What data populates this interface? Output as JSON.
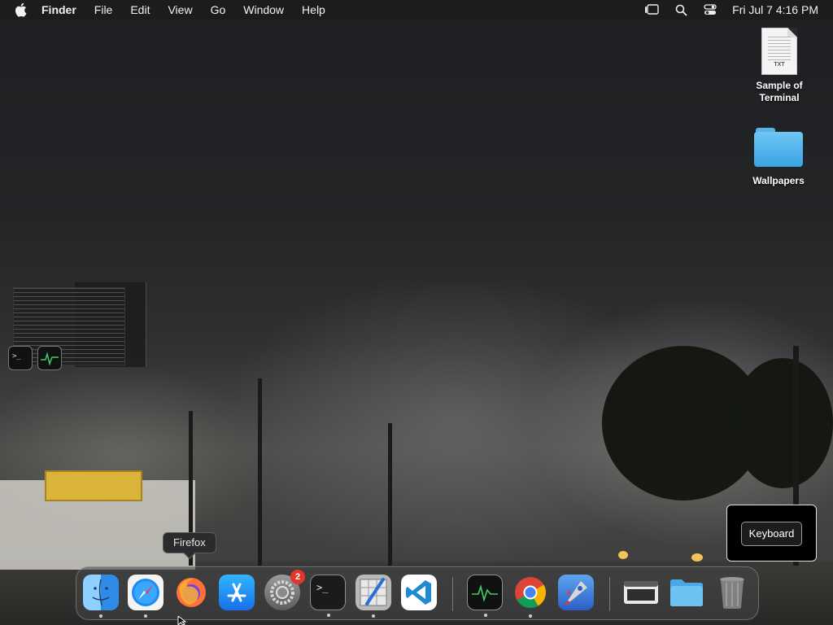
{
  "menubar": {
    "app_name": "Finder",
    "items": [
      "File",
      "Edit",
      "View",
      "Go",
      "Window",
      "Help"
    ],
    "clock": "Fri Jul 7  4:16 PM",
    "right_icons": [
      "stage-manager-icon",
      "spotlight-search-icon",
      "control-center-icon"
    ]
  },
  "desktop": {
    "icons": [
      {
        "label_line1": "Sample of",
        "label_line2": "Terminal",
        "doc_ext": "TXT",
        "icon": "text-document-icon"
      },
      {
        "label": "Wallpapers",
        "icon": "folder-icon"
      }
    ]
  },
  "tooltip": {
    "text": "Firefox"
  },
  "keyboard_panel": {
    "button_label": "Keyboard"
  },
  "dock": {
    "items": [
      {
        "name": "Finder",
        "icon": "finder-icon",
        "running": true
      },
      {
        "name": "Safari",
        "icon": "safari-icon",
        "running": true
      },
      {
        "name": "Firefox",
        "icon": "firefox-icon",
        "running": false
      },
      {
        "name": "App Store",
        "icon": "app-store-icon",
        "running": false
      },
      {
        "name": "System Settings",
        "icon": "system-settings-icon",
        "running": false,
        "badge": "2"
      },
      {
        "name": "Terminal",
        "icon": "terminal-icon",
        "running": true
      },
      {
        "name": "Script Editor",
        "icon": "script-editor-icon",
        "running": true
      },
      {
        "name": "Visual Studio Code",
        "icon": "vscode-icon",
        "running": false
      },
      {
        "name": "Activity Monitor",
        "icon": "activity-monitor-icon",
        "running": true
      },
      {
        "name": "Google Chrome",
        "icon": "chrome-icon",
        "running": true
      },
      {
        "name": "Rocket",
        "icon": "rocket-icon",
        "running": false
      },
      {
        "name": "Preview Window",
        "icon": "window-preview-icon",
        "running": false
      },
      {
        "name": "Folder",
        "icon": "folder-icon",
        "running": false
      },
      {
        "name": "Trash",
        "icon": "trash-icon",
        "running": false
      }
    ]
  }
}
